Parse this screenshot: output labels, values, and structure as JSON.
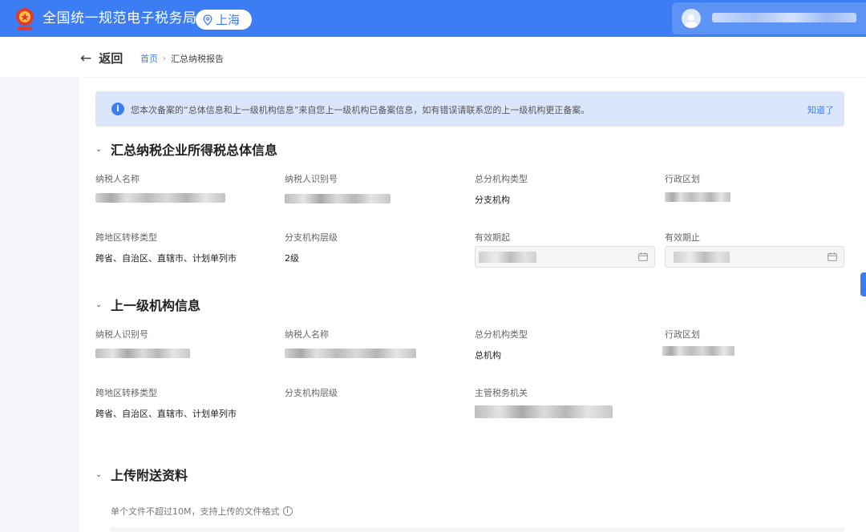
{
  "header": {
    "site_title": "全国统一规范电子税务局",
    "region": "上海",
    "colors": {
      "brand": "#3c7df4",
      "user_box": "#5e93f6"
    },
    "icons": {
      "logo": "tax-emblem-icon",
      "region": "location-pin-icon",
      "user": "user-avatar-icon"
    }
  },
  "nav": {
    "back_label": "返回",
    "breadcrumb": {
      "home": "首页",
      "separator": "›",
      "current": "汇总纳税报告"
    }
  },
  "notice": {
    "message": "您本次备案的“总体信息和上一级机构信息”来自您上一级机构已备案信息，如有错误请联系您的上一级机构更正备案。",
    "action": "知道了",
    "icon": "info-icon"
  },
  "section1": {
    "title": "汇总纳税企业所得税总体信息",
    "fields": [
      {
        "label": "纳税人名称",
        "value": ""
      },
      {
        "label": "纳税人识别号",
        "value": ""
      },
      {
        "label": "总分机构类型",
        "value": "分支机构"
      },
      {
        "label": "行政区划",
        "value": ""
      },
      {
        "label": "跨地区转移类型",
        "value": "跨省、自治区、直辖市、计划单列市"
      },
      {
        "label": "分支机构层级",
        "value": "2级"
      },
      {
        "label": "有效期起",
        "value": ""
      },
      {
        "label": "有效期止",
        "value": ""
      }
    ]
  },
  "section2": {
    "title": "上一级机构信息",
    "fields": [
      {
        "label": "纳税人识别号",
        "value": ""
      },
      {
        "label": "纳税人名称",
        "value": ""
      },
      {
        "label": "总分机构类型",
        "value": "总机构"
      },
      {
        "label": "行政区划",
        "value": ""
      },
      {
        "label": "跨地区转移类型",
        "value": "跨省、自治区、直辖市、计划单列市"
      },
      {
        "label": "分支机构层级",
        "value": ""
      },
      {
        "label": "主管税务机关",
        "value": ""
      }
    ]
  },
  "section3": {
    "title": "上传附送资料",
    "hint": "单个文件不超过10M，支持上传的文件格式"
  }
}
